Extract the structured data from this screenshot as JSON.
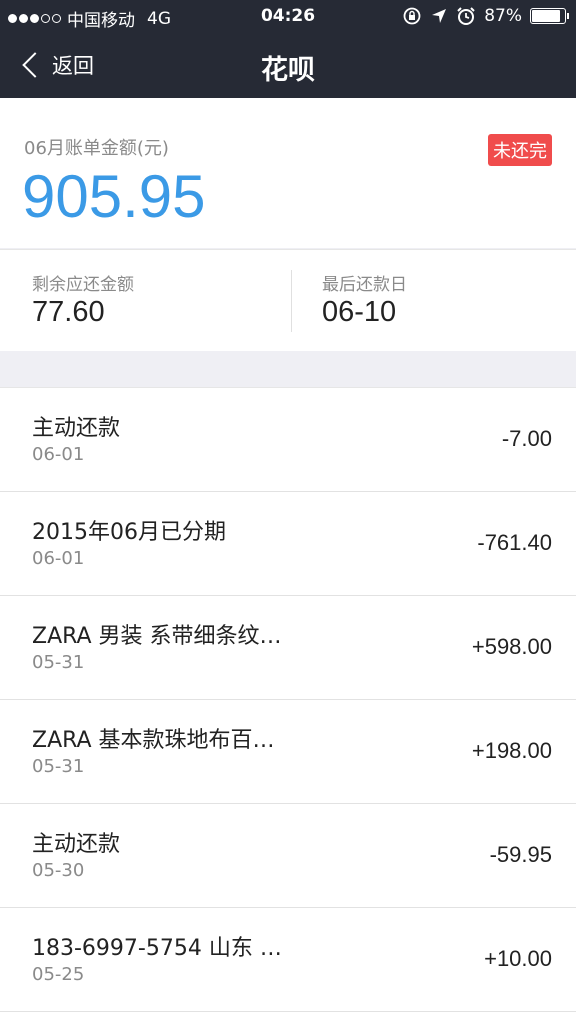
{
  "status_bar": {
    "carrier": "中国移动",
    "network": "4G",
    "time": "04:26",
    "battery": "87%",
    "battery_level": 0.87,
    "signal_bars_filled": 3,
    "signal_bars_total": 5
  },
  "nav": {
    "back_label": "返回",
    "title": "花呗"
  },
  "summary": {
    "bill_label": "06月账单金额(元)",
    "bill_amount": "905.95",
    "status_badge": "未还完",
    "amount_color": "#3b9ae6",
    "badge_color": "#f04c4c"
  },
  "info": {
    "remaining_label": "剩余应还金额",
    "remaining_value": "77.60",
    "due_label": "最后还款日",
    "due_value": "06-10"
  },
  "transactions": [
    {
      "name": "主动还款",
      "date": "06-01",
      "amount": "-7.00"
    },
    {
      "name": "2015年06月已分期",
      "date": "06-01",
      "amount": "-761.40"
    },
    {
      "name": "ZARA 男装 系带细条纹…",
      "date": "05-31",
      "amount": "+598.00"
    },
    {
      "name": "ZARA 基本款珠地布百…",
      "date": "05-31",
      "amount": "+198.00"
    },
    {
      "name": "主动还款",
      "date": "05-30",
      "amount": "-59.95"
    },
    {
      "name": "183-6997-5754 山东 …",
      "date": "05-25",
      "amount": "+10.00"
    }
  ]
}
